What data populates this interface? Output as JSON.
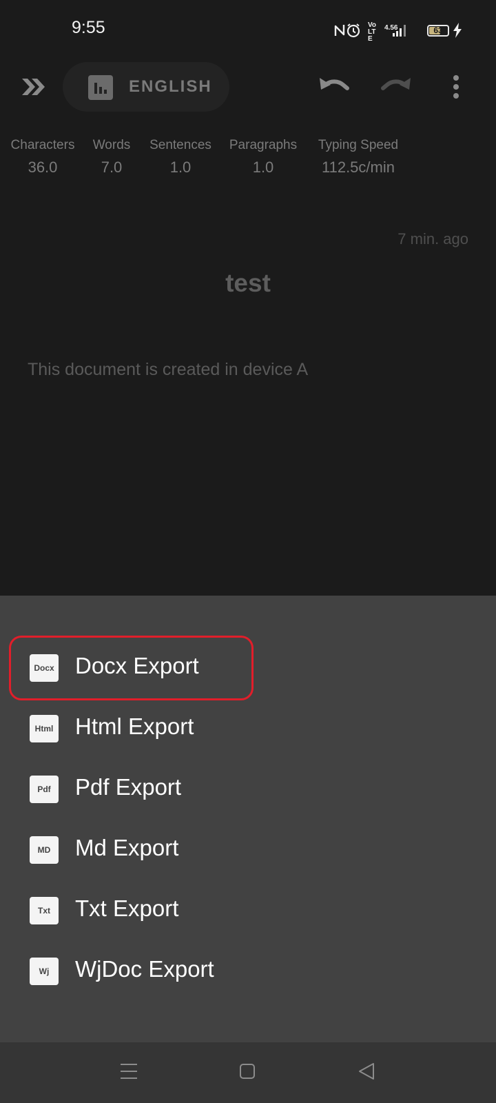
{
  "status_bar": {
    "time": "9:55",
    "battery_level": "63",
    "battery_fraction": 0.63,
    "network_label": "4.56",
    "volte_label": "Vo LTE",
    "icons": [
      "nfc-icon",
      "alarm-icon",
      "volte-icon",
      "signal-icon",
      "battery-icon",
      "charging-icon"
    ]
  },
  "toolbar": {
    "language": "ENGLISH",
    "icons": [
      "expand-icon",
      "stats-icon",
      "undo-icon",
      "redo-icon",
      "more-icon"
    ]
  },
  "stats": [
    {
      "label": "Characters",
      "value": "36.0"
    },
    {
      "label": "Words",
      "value": "7.0"
    },
    {
      "label": "Sentences",
      "value": "1.0"
    },
    {
      "label": "Paragraphs",
      "value": "1.0"
    },
    {
      "label": "Typing Speed",
      "value": "112.5c/min"
    }
  ],
  "document": {
    "timestamp": "7 min. ago",
    "title": "test",
    "body": "This document is created in device A"
  },
  "export_menu": {
    "items": [
      {
        "icon_text": "Docx",
        "label": "Docx Export",
        "highlighted": true
      },
      {
        "icon_text": "Html",
        "label": "Html Export"
      },
      {
        "icon_text": "Pdf",
        "label": "Pdf Export"
      },
      {
        "icon_text": "MD",
        "label": "Md Export"
      },
      {
        "icon_text": "Txt",
        "label": "Txt Export"
      },
      {
        "icon_text": "Wj",
        "label": "WjDoc Export"
      }
    ]
  },
  "nav_bar": {
    "icons": [
      "menu-icon",
      "home-icon",
      "back-icon"
    ]
  },
  "colors": {
    "background": "#1b1b1b",
    "sheet": "#424242",
    "highlight": "#e11e2a",
    "battery": "#c7b47d"
  }
}
